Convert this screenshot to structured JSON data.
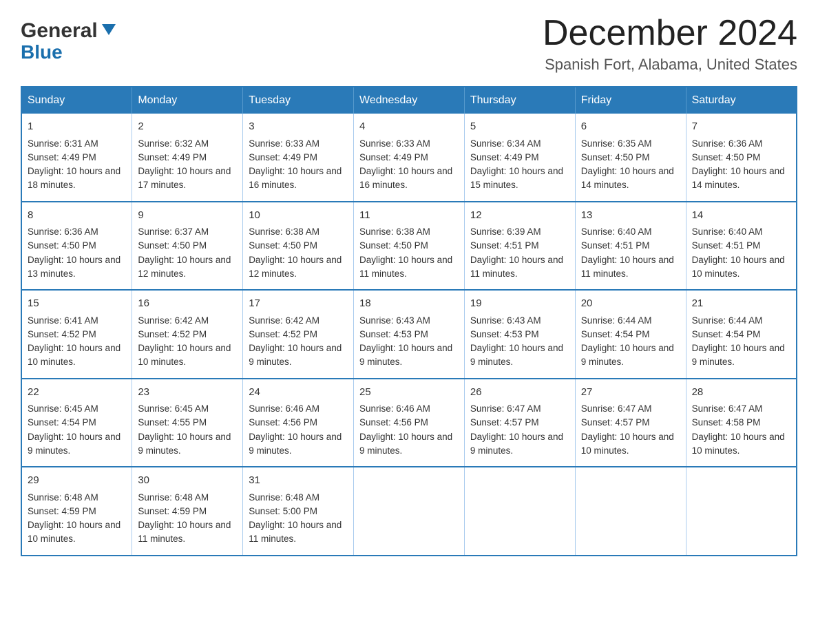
{
  "logo": {
    "general": "General",
    "blue": "Blue"
  },
  "header": {
    "month": "December 2024",
    "location": "Spanish Fort, Alabama, United States"
  },
  "weekdays": [
    "Sunday",
    "Monday",
    "Tuesday",
    "Wednesday",
    "Thursday",
    "Friday",
    "Saturday"
  ],
  "weeks": [
    [
      {
        "day": "1",
        "sunrise": "6:31 AM",
        "sunset": "4:49 PM",
        "daylight": "10 hours and 18 minutes."
      },
      {
        "day": "2",
        "sunrise": "6:32 AM",
        "sunset": "4:49 PM",
        "daylight": "10 hours and 17 minutes."
      },
      {
        "day": "3",
        "sunrise": "6:33 AM",
        "sunset": "4:49 PM",
        "daylight": "10 hours and 16 minutes."
      },
      {
        "day": "4",
        "sunrise": "6:33 AM",
        "sunset": "4:49 PM",
        "daylight": "10 hours and 16 minutes."
      },
      {
        "day": "5",
        "sunrise": "6:34 AM",
        "sunset": "4:49 PM",
        "daylight": "10 hours and 15 minutes."
      },
      {
        "day": "6",
        "sunrise": "6:35 AM",
        "sunset": "4:50 PM",
        "daylight": "10 hours and 14 minutes."
      },
      {
        "day": "7",
        "sunrise": "6:36 AM",
        "sunset": "4:50 PM",
        "daylight": "10 hours and 14 minutes."
      }
    ],
    [
      {
        "day": "8",
        "sunrise": "6:36 AM",
        "sunset": "4:50 PM",
        "daylight": "10 hours and 13 minutes."
      },
      {
        "day": "9",
        "sunrise": "6:37 AM",
        "sunset": "4:50 PM",
        "daylight": "10 hours and 12 minutes."
      },
      {
        "day": "10",
        "sunrise": "6:38 AM",
        "sunset": "4:50 PM",
        "daylight": "10 hours and 12 minutes."
      },
      {
        "day": "11",
        "sunrise": "6:38 AM",
        "sunset": "4:50 PM",
        "daylight": "10 hours and 11 minutes."
      },
      {
        "day": "12",
        "sunrise": "6:39 AM",
        "sunset": "4:51 PM",
        "daylight": "10 hours and 11 minutes."
      },
      {
        "day": "13",
        "sunrise": "6:40 AM",
        "sunset": "4:51 PM",
        "daylight": "10 hours and 11 minutes."
      },
      {
        "day": "14",
        "sunrise": "6:40 AM",
        "sunset": "4:51 PM",
        "daylight": "10 hours and 10 minutes."
      }
    ],
    [
      {
        "day": "15",
        "sunrise": "6:41 AM",
        "sunset": "4:52 PM",
        "daylight": "10 hours and 10 minutes."
      },
      {
        "day": "16",
        "sunrise": "6:42 AM",
        "sunset": "4:52 PM",
        "daylight": "10 hours and 10 minutes."
      },
      {
        "day": "17",
        "sunrise": "6:42 AM",
        "sunset": "4:52 PM",
        "daylight": "10 hours and 9 minutes."
      },
      {
        "day": "18",
        "sunrise": "6:43 AM",
        "sunset": "4:53 PM",
        "daylight": "10 hours and 9 minutes."
      },
      {
        "day": "19",
        "sunrise": "6:43 AM",
        "sunset": "4:53 PM",
        "daylight": "10 hours and 9 minutes."
      },
      {
        "day": "20",
        "sunrise": "6:44 AM",
        "sunset": "4:54 PM",
        "daylight": "10 hours and 9 minutes."
      },
      {
        "day": "21",
        "sunrise": "6:44 AM",
        "sunset": "4:54 PM",
        "daylight": "10 hours and 9 minutes."
      }
    ],
    [
      {
        "day": "22",
        "sunrise": "6:45 AM",
        "sunset": "4:54 PM",
        "daylight": "10 hours and 9 minutes."
      },
      {
        "day": "23",
        "sunrise": "6:45 AM",
        "sunset": "4:55 PM",
        "daylight": "10 hours and 9 minutes."
      },
      {
        "day": "24",
        "sunrise": "6:46 AM",
        "sunset": "4:56 PM",
        "daylight": "10 hours and 9 minutes."
      },
      {
        "day": "25",
        "sunrise": "6:46 AM",
        "sunset": "4:56 PM",
        "daylight": "10 hours and 9 minutes."
      },
      {
        "day": "26",
        "sunrise": "6:47 AM",
        "sunset": "4:57 PM",
        "daylight": "10 hours and 9 minutes."
      },
      {
        "day": "27",
        "sunrise": "6:47 AM",
        "sunset": "4:57 PM",
        "daylight": "10 hours and 10 minutes."
      },
      {
        "day": "28",
        "sunrise": "6:47 AM",
        "sunset": "4:58 PM",
        "daylight": "10 hours and 10 minutes."
      }
    ],
    [
      {
        "day": "29",
        "sunrise": "6:48 AM",
        "sunset": "4:59 PM",
        "daylight": "10 hours and 10 minutes."
      },
      {
        "day": "30",
        "sunrise": "6:48 AM",
        "sunset": "4:59 PM",
        "daylight": "10 hours and 11 minutes."
      },
      {
        "day": "31",
        "sunrise": "6:48 AM",
        "sunset": "5:00 PM",
        "daylight": "10 hours and 11 minutes."
      },
      null,
      null,
      null,
      null
    ]
  ]
}
